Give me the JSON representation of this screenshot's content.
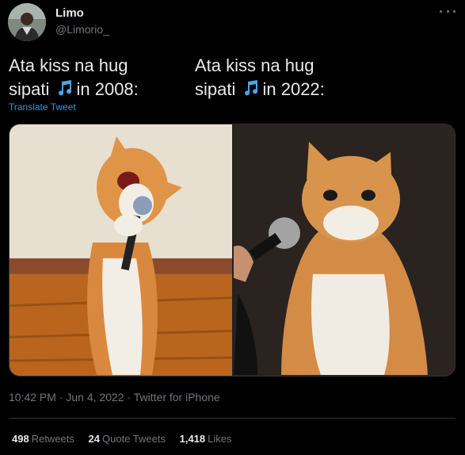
{
  "author": {
    "display_name": "Limo",
    "handle": "@Limorio_"
  },
  "tweet": {
    "left_lines": [
      "Ata kiss na hug",
      "sipati",
      "in 2008:"
    ],
    "right_lines": [
      "Ata kiss na hug",
      "sipati",
      "in 2022:"
    ],
    "notes_icon": "musical-notes-icon",
    "translate_label": "Translate Tweet"
  },
  "meta": {
    "time": "10:42 PM",
    "sep1": " · ",
    "date": "Jun 4, 2022",
    "sep2": " · ",
    "source": "Twitter for iPhone"
  },
  "stats": {
    "retweets_count": "498",
    "retweets_label": "Retweets",
    "quotes_count": "24",
    "quotes_label": "Quote Tweets",
    "likes_count": "1,418",
    "likes_label": "Likes"
  },
  "colors": {
    "background": "#000000",
    "text": "#e7e9ea",
    "muted": "#71767b",
    "link": "#1d9bf0",
    "notes": "#4fa3e8"
  }
}
